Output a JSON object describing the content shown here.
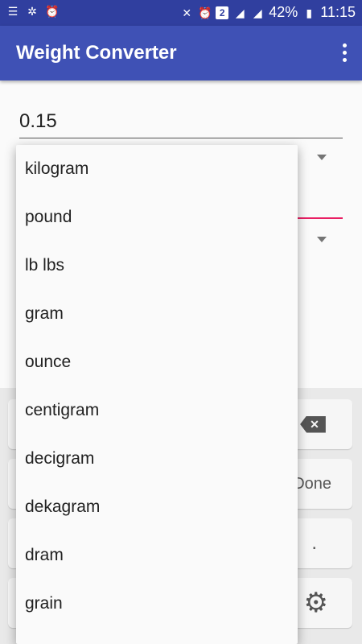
{
  "status_bar": {
    "battery_percent": "42%",
    "time": "11:15",
    "sim_badge": "2"
  },
  "app_bar": {
    "title": "Weight Converter"
  },
  "input": {
    "value": "0.15"
  },
  "dropdown": {
    "items": [
      "kilogram",
      "pound",
      "lb lbs",
      "gram",
      "ounce",
      "centigram",
      "decigram",
      "dekagram",
      "dram",
      "grain"
    ]
  },
  "keyboard": {
    "done_label": "Done",
    "dot_label": "."
  },
  "colors": {
    "primary": "#3f51b5",
    "primary_dark": "#303f9f",
    "accent": "#e91e63"
  }
}
